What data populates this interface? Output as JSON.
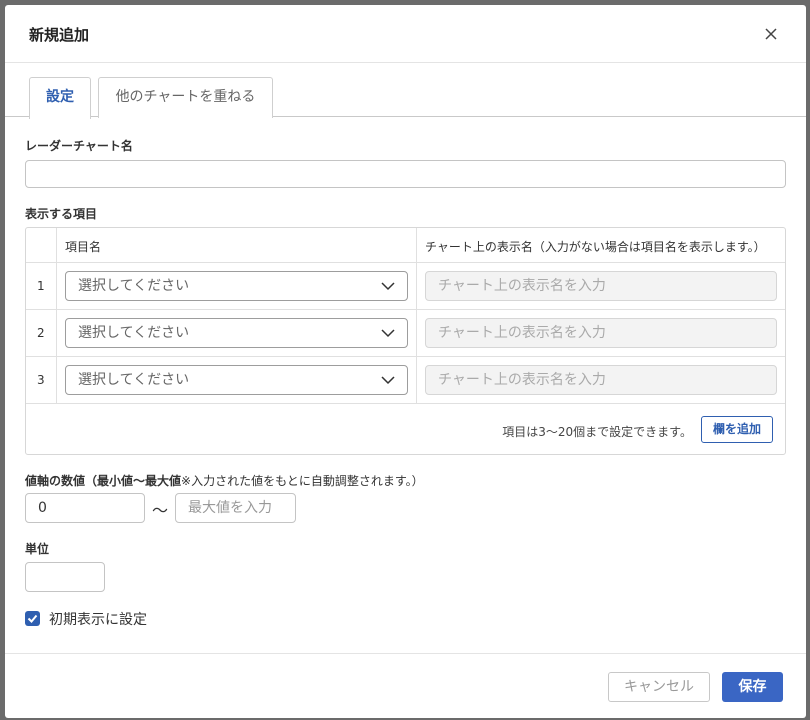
{
  "modal": {
    "title": "新規追加"
  },
  "tabs": [
    {
      "label": "設定",
      "active": true
    },
    {
      "label": "他のチャートを重ねる",
      "active": false
    }
  ],
  "radar_name": {
    "label": "レーダーチャート名",
    "value": ""
  },
  "items": {
    "label": "表示する項目",
    "col_item": "項目名",
    "col_display": "チャート上の表示名（入力がない場合は項目名を表示します。）",
    "rows": [
      {
        "num": "1",
        "select": "選択してください",
        "placeholder": "チャート上の表示名を入力"
      },
      {
        "num": "2",
        "select": "選択してください",
        "placeholder": "チャート上の表示名を入力"
      },
      {
        "num": "3",
        "select": "選択してください",
        "placeholder": "チャート上の表示名を入力"
      }
    ],
    "note": "項目は3〜20個まで設定できます。",
    "add_button": "欄を追加"
  },
  "range": {
    "label_bold": "値軸の数値（最小値〜最大値",
    "label_note": "※入力された値をもとに自動調整されます。）",
    "min_value": "0",
    "tilde": "〜",
    "max_placeholder": "最大値を入力"
  },
  "unit": {
    "label": "単位",
    "value": ""
  },
  "default_display": {
    "label": "初期表示に設定",
    "checked": true
  },
  "footer": {
    "cancel": "キャンセル",
    "save": "保存"
  },
  "colors": {
    "accent": "#2f5fb0",
    "save_bg": "#3a66c4"
  }
}
